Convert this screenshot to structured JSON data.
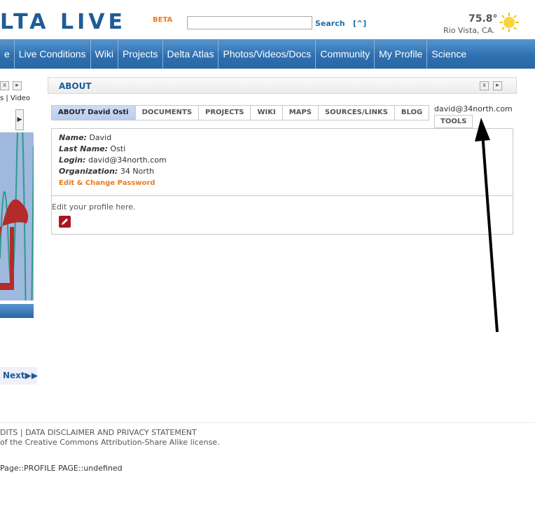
{
  "header": {
    "logo_text": "LTA LIVE",
    "beta": "BETA",
    "search_value": "",
    "search_label": "Search",
    "expand_label": "[^]",
    "temperature": "75.8°",
    "city": "Rio Vista, CA."
  },
  "nav": {
    "items": [
      "e",
      "Live Conditions",
      "Wiki",
      "Projects",
      "Delta Atlas",
      "Photos/Videos/Docs",
      "Community",
      "My Profile",
      "Science"
    ]
  },
  "left_panel": {
    "tabs_text": "s | Video",
    "next_label": "Next"
  },
  "about": {
    "title": "ABOUT",
    "tabs": [
      "ABOUT David Osti",
      "DOCUMENTS",
      "PROJECTS",
      "WIKI",
      "MAPS",
      "SOURCES/LINKS",
      "BLOG"
    ],
    "tools_tab": "TOOLS",
    "login_email": "david@34north.com",
    "name_label": "Name:",
    "name_value": "David",
    "last_name_label": "Last Name:",
    "last_name_value": "Osti",
    "login_label": "Login:",
    "login_value": "david@34north.com",
    "org_label": "Organization:",
    "org_value": "34 North",
    "change_password": "Edit & Change Password",
    "edit_profile_text": "Edit your profile here."
  },
  "footer": {
    "links": "DITS | DATA DISCLAIMER AND PRIVACY STATEMENT",
    "license": "of the Creative Commons Attribution-Share Alike license.",
    "page_info": "Page::PROFILE PAGE::undefined"
  },
  "colors": {
    "brand_blue": "#1e5c96",
    "accent_orange": "#e87c1e",
    "nav_blue": "#2f70b1"
  }
}
